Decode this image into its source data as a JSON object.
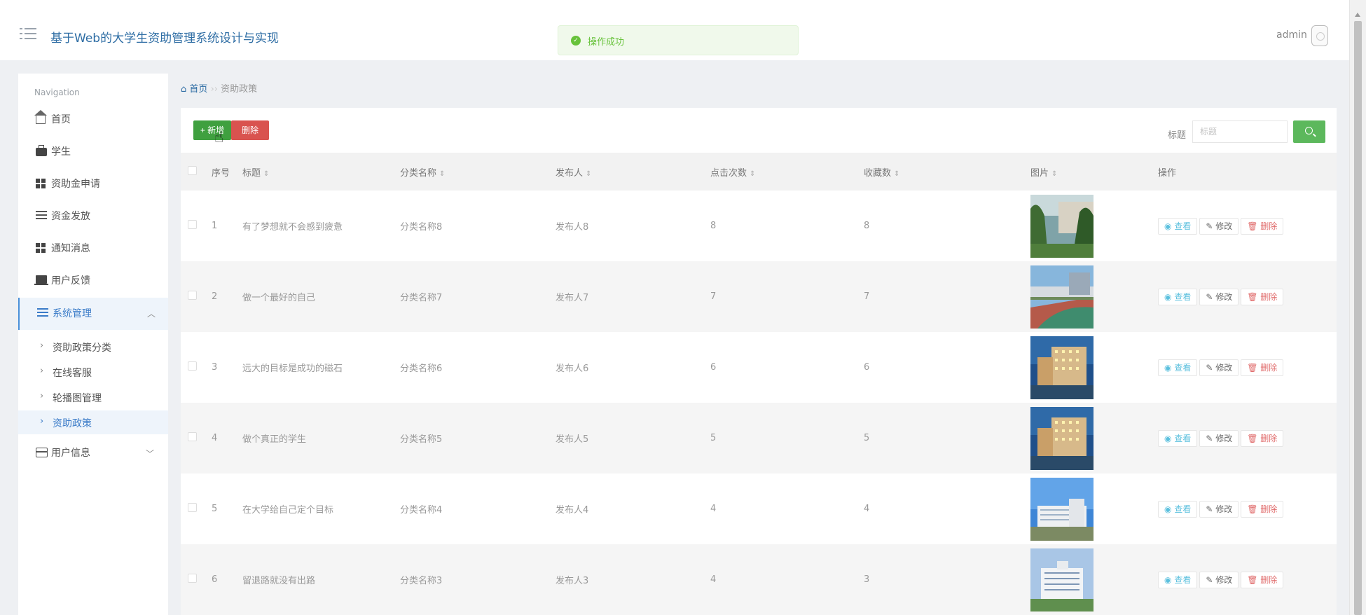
{
  "header": {
    "title": "基于Web的大学生资助管理系统设计与实现",
    "toast": "操作成功",
    "user": "admin"
  },
  "sidebar": {
    "heading": "Navigation",
    "items": [
      {
        "label": "首页",
        "icon": "home-icon"
      },
      {
        "label": "学生",
        "icon": "briefcase-icon"
      },
      {
        "label": "资助金申请",
        "icon": "grid-icon"
      },
      {
        "label": "资金发放",
        "icon": "sliders-icon"
      },
      {
        "label": "通知消息",
        "icon": "grid-icon"
      },
      {
        "label": "用户反馈",
        "icon": "laptop-icon"
      },
      {
        "label": "系统管理",
        "icon": "list-icon"
      },
      {
        "label": "用户信息",
        "icon": "card-icon"
      }
    ],
    "sub_items": [
      "资助政策分类",
      "在线客服",
      "轮播图管理",
      "资助政策"
    ]
  },
  "breadcrumb": {
    "home": "首页",
    "separator": "››",
    "current": "资助政策"
  },
  "toolbar": {
    "add_label": "+ 新增",
    "delete_label": "删除",
    "search_label": "标题",
    "search_placeholder": "标题"
  },
  "table": {
    "columns": [
      "序号",
      "标题",
      "分类名称",
      "发布人",
      "点击次数",
      "收藏数",
      "图片",
      "操作"
    ],
    "sort_glyph": "⇕",
    "actions": {
      "view": "查看",
      "edit": "修改",
      "delete": "删除"
    },
    "rows": [
      {
        "index": "1",
        "title": "有了梦想就不会感到疲惫",
        "category": "分类名称8",
        "publisher": "发布人8",
        "clicks": "8",
        "favorites": "8",
        "image": "campus-garden"
      },
      {
        "index": "2",
        "title": "做一个最好的自己",
        "category": "分类名称7",
        "publisher": "发布人7",
        "clicks": "7",
        "favorites": "7",
        "image": "campus-track"
      },
      {
        "index": "3",
        "title": "远大的目标是成功的磁石",
        "category": "分类名称6",
        "publisher": "发布人6",
        "clicks": "6",
        "favorites": "6",
        "image": "campus-building-night"
      },
      {
        "index": "4",
        "title": "做个真正的学生",
        "category": "分类名称5",
        "publisher": "发布人5",
        "clicks": "5",
        "favorites": "5",
        "image": "campus-building-night"
      },
      {
        "index": "5",
        "title": "在大学给自己定个目标",
        "category": "分类名称4",
        "publisher": "发布人4",
        "clicks": "4",
        "favorites": "4",
        "image": "campus-building-day"
      },
      {
        "index": "6",
        "title": "留退路就没有出路",
        "category": "分类名称3",
        "publisher": "发布人3",
        "clicks": "4",
        "favorites": "3",
        "image": "campus-building-white"
      }
    ]
  }
}
